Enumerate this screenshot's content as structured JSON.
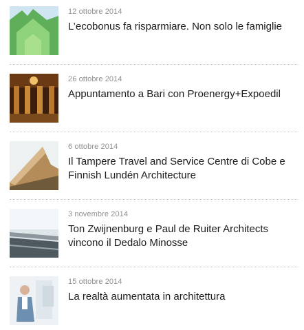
{
  "news": [
    {
      "date": "12 ottobre 2014",
      "title": "L’ecobonus fa risparmiare. Non solo le famiglie",
      "thumb_icon": "ecobonus-house-thumbnail"
    },
    {
      "date": "26 ottobre 2014",
      "title": "Appuntamento a Bari con Proenergy+Expoedil",
      "thumb_icon": "bari-event-thumbnail"
    },
    {
      "date": "6 ottobre 2014",
      "title": "Il Tampere Travel and Service Centre di Cobe e Finnish Lundén Architecture",
      "thumb_icon": "tampere-building-thumbnail"
    },
    {
      "date": "3 novembre 2014",
      "title": "Ton Zwijnenburg e Paul de Ruiter Architects vincono il Dedalo Minosse",
      "thumb_icon": "road-bridge-thumbnail"
    },
    {
      "date": "15 ottobre 2014",
      "title": "La realtà aumentata in architettura",
      "thumb_icon": "augmented-reality-thumbnail"
    }
  ],
  "colors": {
    "date": "#8f8f8f",
    "title": "#1b1b1b",
    "separator": "#c9c9c9"
  }
}
